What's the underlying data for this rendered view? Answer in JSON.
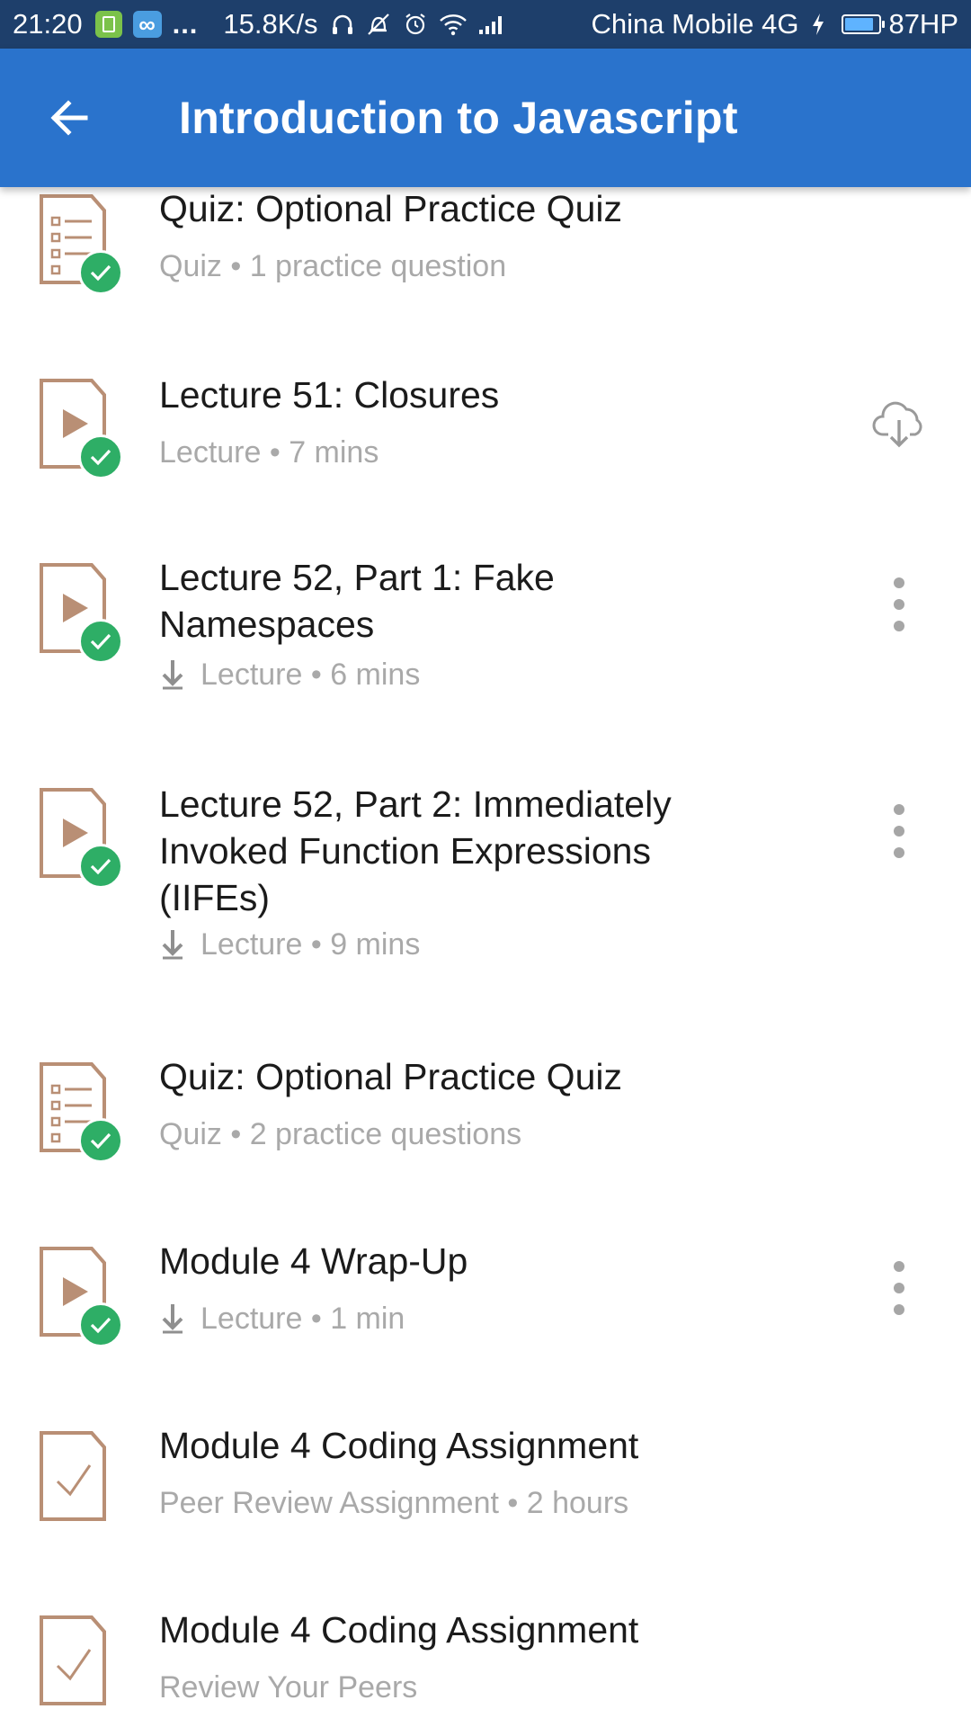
{
  "status_bar": {
    "time": "21:20",
    "app_icon_blue_glyph": "∞",
    "more_dots": "...",
    "network_speed": "15.8K/s",
    "carrier": "China Mobile 4G",
    "battery_text": "87HP",
    "battery_level": 0.87
  },
  "header": {
    "title": "Introduction to Javascript"
  },
  "colors": {
    "status_bar_bg": "#1e3f6b",
    "app_bar_bg": "#2a73cc",
    "check_green": "#2eae66",
    "icon_tan": "#b98f75",
    "subtitle_gray": "#a9a9a9",
    "action_gray": "#9a9a9a"
  },
  "items": [
    {
      "type": "quiz",
      "completed": true,
      "title": "Quiz: Optional Practice Quiz",
      "subtitle": "Quiz • 1 practice question",
      "downloaded": false,
      "action": "none"
    },
    {
      "type": "lecture",
      "completed": true,
      "title": "Lecture 51: Closures",
      "subtitle": "Lecture • 7 mins",
      "downloaded": false,
      "action": "cloud-download-icon"
    },
    {
      "type": "lecture",
      "completed": true,
      "title": "Lecture 52, Part 1: Fake Namespaces",
      "subtitle": "Lecture • 6 mins",
      "downloaded": true,
      "action": "more-vert-icon"
    },
    {
      "type": "lecture",
      "completed": true,
      "title": "Lecture 52, Part 2: Immediately Invoked Function Expressions (IIFEs)",
      "subtitle": "Lecture • 9 mins",
      "downloaded": true,
      "action": "more-vert-icon"
    },
    {
      "type": "quiz",
      "completed": true,
      "title": "Quiz: Optional Practice Quiz",
      "subtitle": "Quiz • 2 practice questions",
      "downloaded": false,
      "action": "none"
    },
    {
      "type": "lecture",
      "completed": true,
      "title": "Module 4 Wrap-Up",
      "subtitle": "Lecture • 1 min",
      "downloaded": true,
      "action": "more-vert-icon"
    },
    {
      "type": "assignment",
      "completed": false,
      "title": "Module 4 Coding Assignment",
      "subtitle": "Peer Review Assignment • 2 hours",
      "downloaded": false,
      "action": "none"
    },
    {
      "type": "assignment",
      "completed": false,
      "title": "Module 4 Coding Assignment",
      "subtitle": "Review Your Peers",
      "downloaded": false,
      "action": "none"
    }
  ]
}
